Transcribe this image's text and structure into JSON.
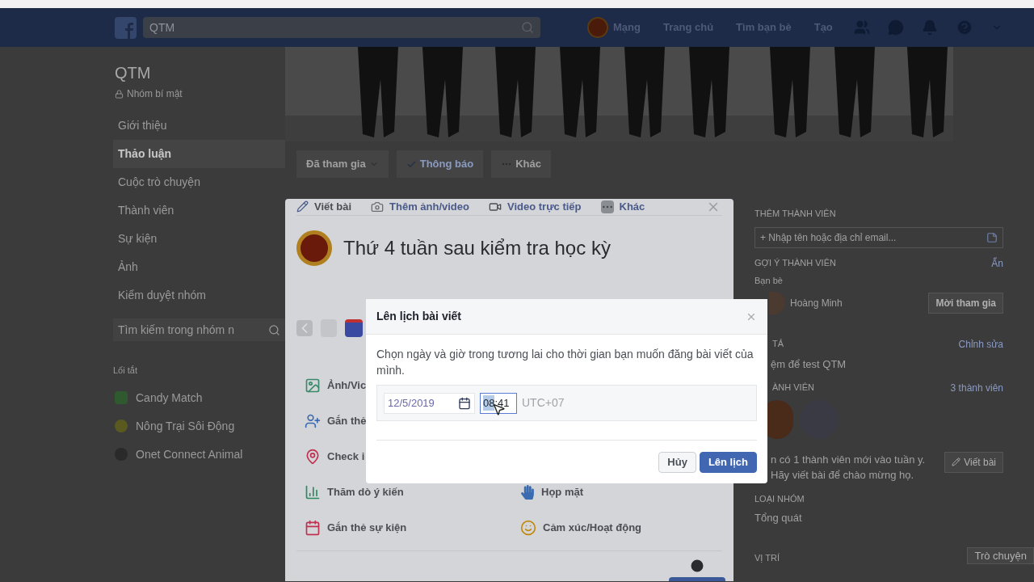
{
  "nav": {
    "search": "QTM",
    "profile": "Mạng",
    "links": [
      "Trang chủ",
      "Tìm bạn bè",
      "Tạo"
    ]
  },
  "sidebar": {
    "group_name": "QTM",
    "privacy": "Nhóm bí mật",
    "items": [
      {
        "label": "Giới thiệu",
        "selected": false
      },
      {
        "label": "Thảo luận",
        "selected": true
      },
      {
        "label": "Cuộc trò chuyện",
        "selected": false
      },
      {
        "label": "Thành viên",
        "selected": false
      },
      {
        "label": "Sự kiện",
        "selected": false
      },
      {
        "label": "Ảnh",
        "selected": false
      },
      {
        "label": "Kiểm duyệt nhóm",
        "selected": false
      }
    ],
    "search_placeholder": "Tìm kiếm trong nhóm n",
    "shortcuts_title": "Lối tắt",
    "shortcuts": [
      {
        "label": "Candy Match",
        "kind": "candy"
      },
      {
        "label": "Nông Trại Sôi Động",
        "kind": "farm"
      },
      {
        "label": "Onet Connect Animal",
        "kind": "animal"
      }
    ]
  },
  "group_actions": [
    {
      "label": "Đã tham gia",
      "kind": "dropdown"
    },
    {
      "label": "Thông báo",
      "kind": "check"
    },
    {
      "label": "Khác",
      "kind": "more"
    }
  ],
  "composer": {
    "tabs": [
      {
        "label": "Viết bài",
        "kind": "write",
        "selected": true
      },
      {
        "label": "Thêm ảnh/video",
        "selected": false
      },
      {
        "label": "Video trực tiếp",
        "kind": "video",
        "selected": false
      },
      {
        "label": "Khác",
        "kind": "more",
        "selected": false
      }
    ],
    "text": "Thứ 4 tuần sau kiểm tra học kỳ",
    "options_left": [
      {
        "label": "Ảnh/Vic"
      },
      {
        "label": "Gắn thẻ",
        "kind": "tag"
      },
      {
        "label": "Check i",
        "kind": "place"
      },
      {
        "label": "Thăm dò ý kiến",
        "kind": "poll"
      },
      {
        "label": "Gắn thẻ sự kiện",
        "kind": "event"
      }
    ],
    "options_right": [
      {
        "label": "Họp mặt",
        "kind": "meet"
      },
      {
        "label": "Cảm xúc/Hoạt động",
        "kind": "feeling"
      }
    ]
  },
  "dialog": {
    "title": "Lên lịch bài viết",
    "text": "Chọn ngày và giờ trong tương lai cho thời gian bạn muốn đăng bài viết của mình.",
    "date": "12/5/2019",
    "time": [
      {
        "text": "08",
        "selected": true
      },
      {
        "text": "41",
        "selected": false
      }
    ],
    "separator": ":",
    "timezone": "UTC+07",
    "buttons": [
      {
        "label": "Hủy",
        "kind": "secondary"
      },
      {
        "label": "Lên lịch",
        "kind": "primary"
      }
    ]
  },
  "right": {
    "add_title": "THÊM THÀNH VIÊN",
    "add_placeholder": "+ Nhập tên hoặc địa chỉ email...",
    "suggest_title": "GỢI Ý THÀNH VIÊN",
    "suggest_action": "Ẩn",
    "suggest_subtitle": "Bạn bè",
    "person": {
      "name": "Hoàng Minh",
      "button": "Mời tham gia"
    },
    "desc_title": "TẢ",
    "desc_action": "Chỉnh sửa",
    "desc_text": "ệm để test QTM",
    "members_title": "ÀNH VIÊN",
    "members_count": "3 thành viên",
    "members_note": "n có 1 thành viên mới vào tuần y. Hãy viết bài để chào mừng họ.",
    "members_button": "Viết bài",
    "type_title": "LOẠI NHÓM",
    "type_value": "Tổng quát",
    "location_title": "VỊ TRÍ",
    "chat": "Trò chuyện"
  }
}
